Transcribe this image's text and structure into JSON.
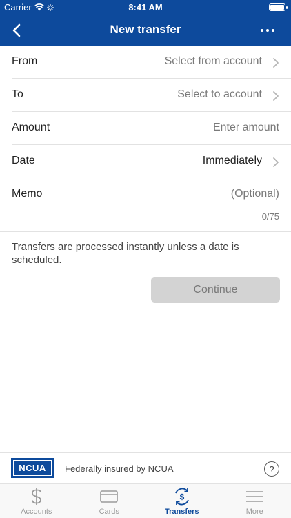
{
  "status_bar": {
    "carrier": "Carrier",
    "time": "8:41 AM"
  },
  "nav": {
    "title": "New transfer"
  },
  "form": {
    "from": {
      "label": "From",
      "value": "Select from account"
    },
    "to": {
      "label": "To",
      "value": "Select to account"
    },
    "amount": {
      "label": "Amount",
      "placeholder": "Enter amount"
    },
    "date": {
      "label": "Date",
      "value": "Immediately"
    },
    "memo": {
      "label": "Memo",
      "placeholder": "(Optional)",
      "count": "0/75"
    }
  },
  "note": "Transfers are processed instantly unless a date is scheduled.",
  "continue_label": "Continue",
  "footer": {
    "logo_text": "NCUA",
    "insured_text": "Federally insured by NCUA",
    "help": "?"
  },
  "tabs": [
    {
      "label": "Accounts",
      "icon": "dollar-icon",
      "active": false
    },
    {
      "label": "Cards",
      "icon": "card-icon",
      "active": false
    },
    {
      "label": "Transfers",
      "icon": "transfer-icon",
      "active": true
    },
    {
      "label": "More",
      "icon": "menu-icon",
      "active": false
    }
  ],
  "colors": {
    "brand": "#0d4a9c",
    "disabled_button": "#d3d3d3",
    "muted_text": "#7a7a7a"
  }
}
